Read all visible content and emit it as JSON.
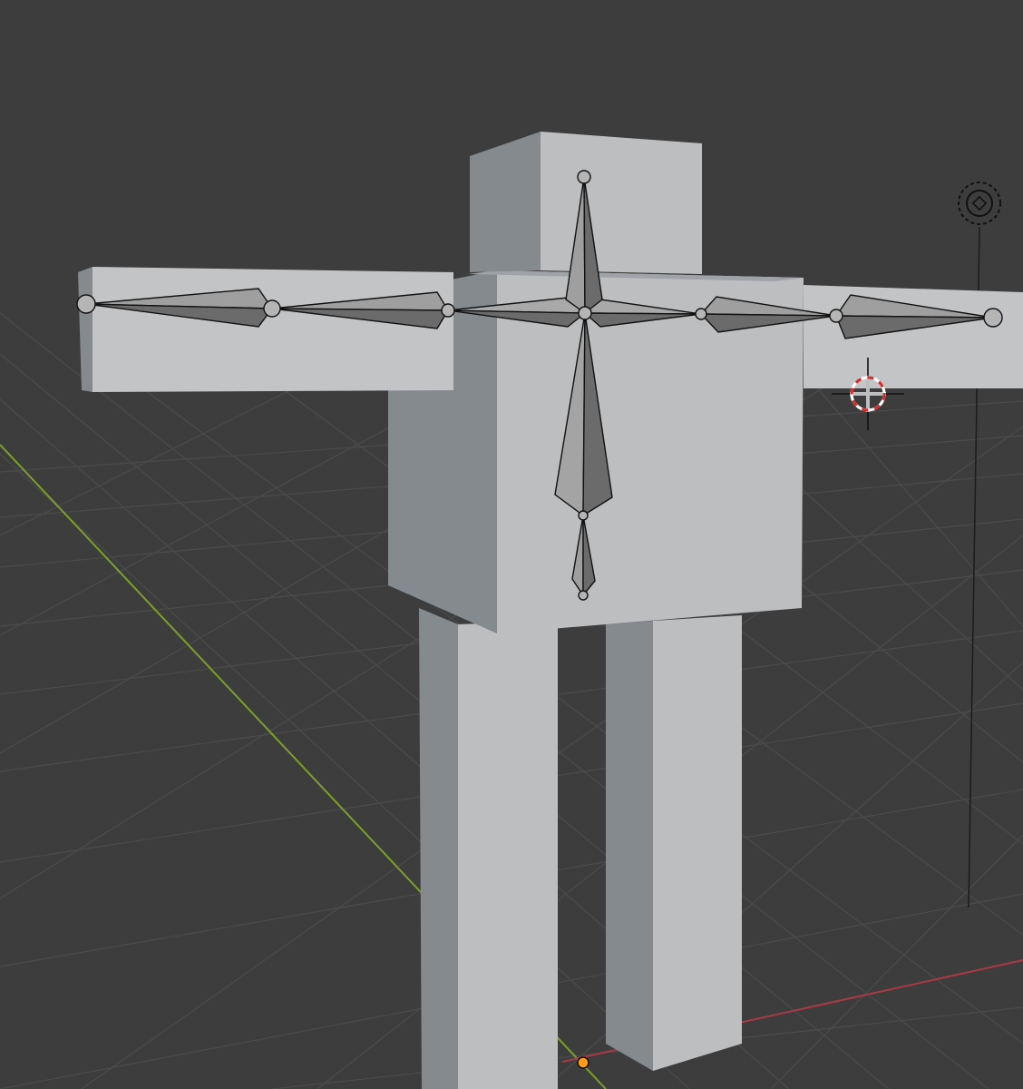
{
  "viewport": {
    "background": "#3d3d3d",
    "view": "perspective"
  },
  "colors": {
    "grid_line": "#4a4a4a",
    "x_axis": "#a83a44",
    "y_axis": "#7aa12a",
    "z_axis": "#1c1c1c",
    "mesh_light": "#c8c9cb",
    "mesh_front": "#b9babc",
    "mesh_side": "#858a8f",
    "mesh_top": "#9fa2a6",
    "bone_light": "#a9a9a9",
    "bone_dark": "#5f5f5f",
    "bone_outline": "#111111",
    "origin_dot": "#ff9a1a",
    "cursor_red": "#d62b2b"
  },
  "scene_objects": [
    {
      "name": "character-mesh",
      "type": "mesh",
      "parts": [
        "head",
        "torso",
        "left-arm",
        "right-arm",
        "left-leg",
        "right-leg"
      ]
    },
    {
      "name": "armature",
      "type": "armature",
      "bones": [
        "spine",
        "spine-lower",
        "neck-head",
        "shoulder-left",
        "upper-arm-left",
        "forearm-left",
        "shoulder-right",
        "upper-arm-right",
        "forearm-right"
      ]
    }
  ],
  "icons": [
    "3d-cursor-icon",
    "light-source-icon",
    "object-origin-icon"
  ]
}
